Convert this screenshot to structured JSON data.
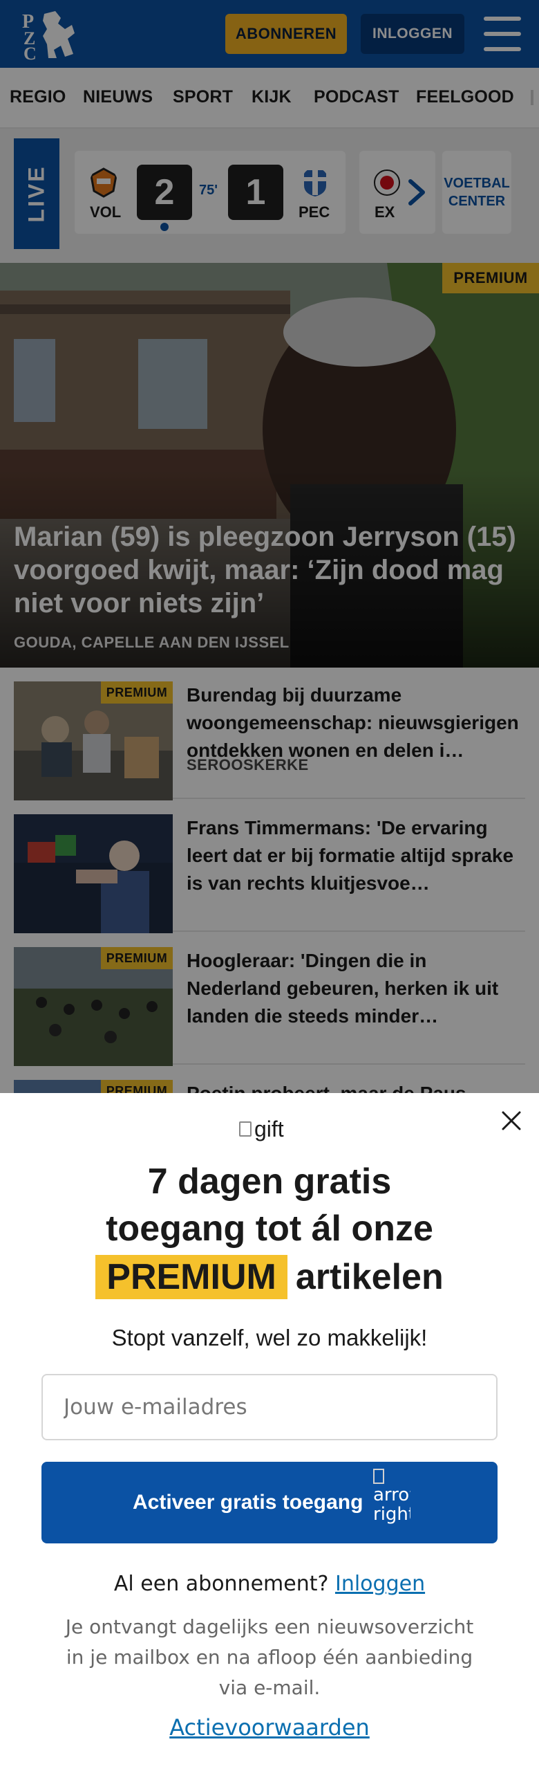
{
  "header": {
    "subscribe_label": "ABONNEREN",
    "login_label": "INLOGGEN",
    "logo_letters": [
      "P",
      "Z",
      "C"
    ],
    "brand_color": "#0b52a4",
    "accent_color": "#f5b324"
  },
  "nav": {
    "items": [
      "REGIO",
      "NIEUWS",
      "SPORT",
      "KIJK",
      "PODCAST",
      "FEELGOOD"
    ]
  },
  "live": {
    "label": "LIVE",
    "match": {
      "home": "VOL",
      "away": "PEC",
      "home_score": "2",
      "away_score": "1",
      "minute": "75'"
    },
    "next_team": "EX",
    "voetbal_center": [
      "VOETBAL",
      "CENTER"
    ]
  },
  "hero": {
    "badge": "PREMIUM",
    "title": "Marian (59) is pleegzoon Jerryson (15) voorgoed kwijt, maar: ‘Zijn dood mag niet voor niets zijn’",
    "location": "GOUDA, CAPELLE AAN DEN IJSSEL"
  },
  "articles": [
    {
      "badge": "PREMIUM",
      "title": "Burendag bij duurzame woongemeenschap: nieuwsgieri­gen ontdekken wonen en delen i…",
      "location": "SEROOSKERKE"
    },
    {
      "badge": "",
      "title": "Frans Timmermans: 'De ervaring leert dat er bij formatie altijd sprake is van rechts kluitjesvoe…",
      "location": ""
    },
    {
      "badge": "PREMIUM",
      "title": "Hoogleraar: 'Dingen die in Nederland gebeuren, herken ik uit landen die steeds minder…",
      "location": ""
    },
    {
      "badge": "PREMIUM",
      "title": "Poetin probeert, maar de Paus…",
      "location": ""
    }
  ],
  "modal": {
    "gift_alt": "gift",
    "title_line1": "7 dagen gratis",
    "title_line2": "toegang tot ál onze",
    "title_premium": "PREMIUM",
    "title_tail": "artikelen",
    "subtitle": "Stopt vanzelf, wel zo makkelijk!",
    "email_placeholder": "Jouw e-mailadres",
    "cta_label": "Activeer gratis toegang",
    "cta_icon_alt": "arrow right",
    "have_sub_text": "Al een abonnement?",
    "have_sub_link": "Inloggen",
    "disclaimer": "Je ontvangt dagelijks een nieuwsoverzicht in je mailbox en na afloop één aanbieding via e-mail.",
    "terms": "Actievoorwaarden"
  }
}
